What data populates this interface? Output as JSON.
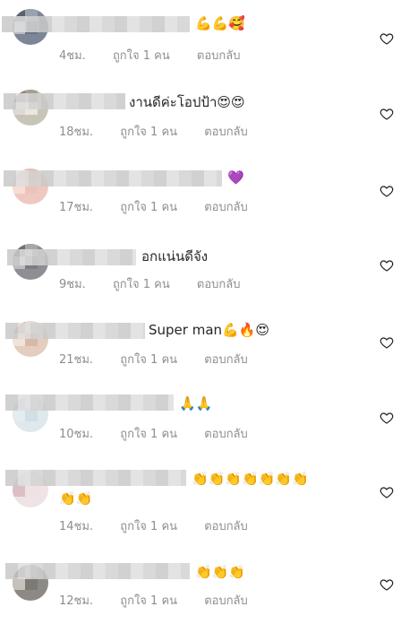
{
  "comments": [
    {
      "text": "💪💪🥰",
      "time": "4ชม.",
      "likes": "ถูกใจ 1 คน",
      "reply": "ตอบกลับ"
    },
    {
      "text": "งานดีค่ะโอปป้า😍😍",
      "time": "18ชม.",
      "likes": "ถูกใจ 1 คน",
      "reply": "ตอบกลับ"
    },
    {
      "text": "💜",
      "time": "17ชม.",
      "likes": "ถูกใจ 1 คน",
      "reply": "ตอบกลับ"
    },
    {
      "text": "อกแน่นดีจัง",
      "time": "9ชม.",
      "likes": "ถูกใจ 1 คน",
      "reply": "ตอบกลับ"
    },
    {
      "text": "Super man💪🔥😍",
      "time": "21ชม.",
      "likes": "ถูกใจ 1 คน",
      "reply": "ตอบกลับ"
    },
    {
      "text": "🙏🙏",
      "time": "10ชม.",
      "likes": "ถูกใจ 1 คน",
      "reply": "ตอบกลับ"
    },
    {
      "text": "👏👏👏👏👏👏👏",
      "text2": "👏👏",
      "time": "14ชม.",
      "likes": "ถูกใจ 1 คน",
      "reply": "ตอบกลับ"
    },
    {
      "text": "👏👏👏",
      "time": "12ชม.",
      "likes": "ถูกใจ 1 คน",
      "reply": "ตอบกลับ"
    }
  ],
  "icons": {
    "like": "heart-outline-icon"
  },
  "colors": {
    "meta": "#8e8e8e",
    "text": "#262626"
  }
}
